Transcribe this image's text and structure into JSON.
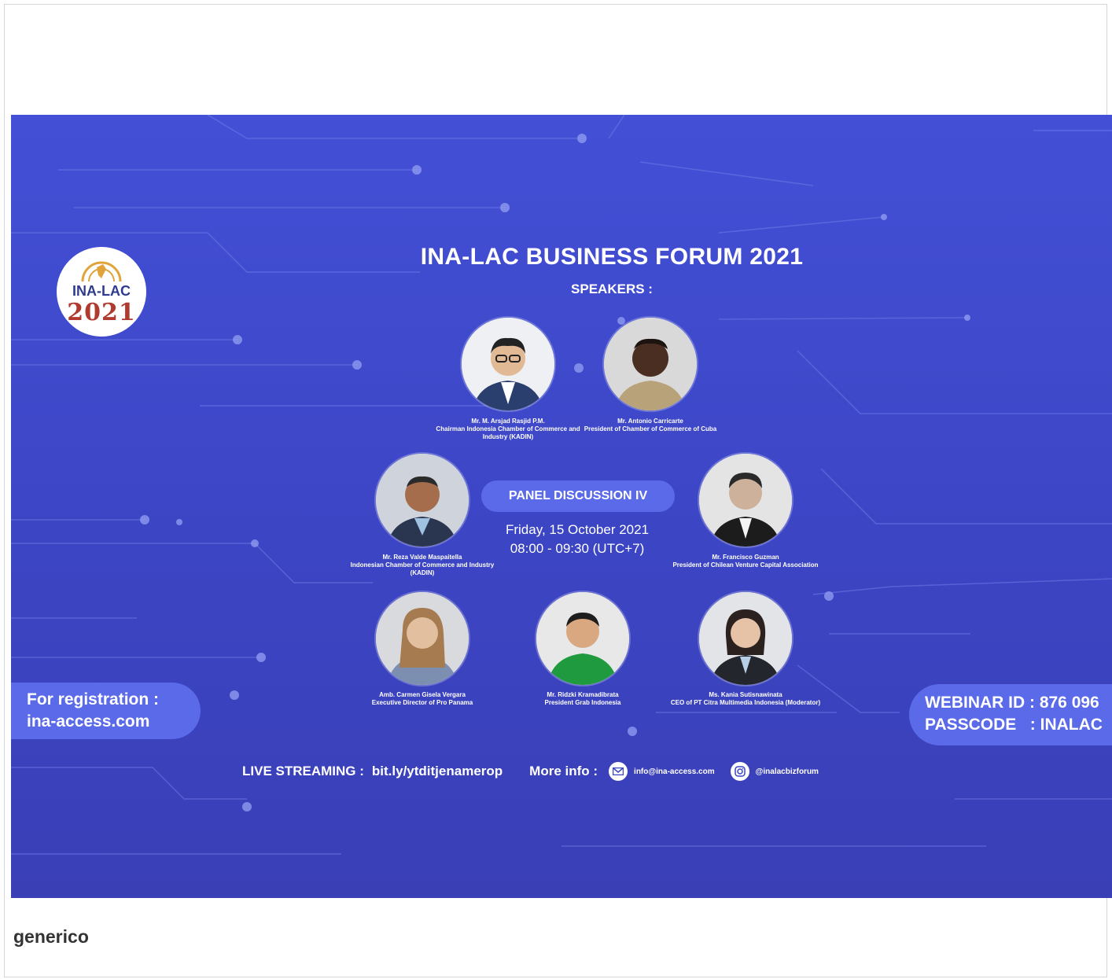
{
  "banner": {
    "logo": {
      "name": "INA-LAC",
      "year": "2021"
    },
    "title": "INA-LAC BUSINESS FORUM 2021",
    "speakers_heading": "SPEAKERS :",
    "speakers": [
      {
        "name": "Mr. M. Arsjad Rasjid P.M.",
        "role": "Chairman Indonesia Chamber of Commerce and Industry (KADIN)",
        "photo": "man-portrait"
      },
      {
        "name": "Mr. Antonio Carricarte",
        "role": "President of Chamber of Commerce of Cuba",
        "photo": "man-portrait"
      },
      {
        "name": "Mr. Reza Valde Maspaitella",
        "role": "Indonesian Chamber of Commerce and Industry (KADIN)",
        "photo": "man-portrait"
      },
      {
        "name": "Mr. Francisco Guzman",
        "role": "President of Chilean Venture Capital Association",
        "photo": "man-portrait"
      },
      {
        "name": "Amb. Carmen Gisela Vergara",
        "role": "Executive Director of Pro Panama",
        "photo": "woman-portrait"
      },
      {
        "name": "Mr. Ridzki Kramadibrata",
        "role": "President Grab Indonesia",
        "photo": "man-portrait"
      },
      {
        "name": "Ms. Kania Sutisnawinata",
        "role": "CEO of PT Citra Multimedia Indonesia (Moderator)",
        "photo": "woman-portrait"
      }
    ],
    "panel": "PANEL DISCUSSION IV",
    "date": "Friday, 15 October 2021",
    "time": "08:00 - 09:30 (UTC+7)",
    "registration": {
      "line1": "For registration :",
      "line2": "ina-access.com"
    },
    "webinar": {
      "id_line": "WEBINAR ID : 876 096",
      "pass_line": "PASSCODE   : INALAC"
    },
    "footer": {
      "live_label": "LIVE STREAMING :",
      "live_link": "bit.ly/ytditjenamerop",
      "more_label": "More info :",
      "email": "info@ina-access.com",
      "instagram": "@inalacbizforum",
      "email_icon": "mail-icon",
      "instagram_icon": "instagram-icon"
    },
    "colors": {
      "background": "#4350d6",
      "pill": "#5a6ae8",
      "text": "#ffffff"
    }
  },
  "tag": "generico"
}
